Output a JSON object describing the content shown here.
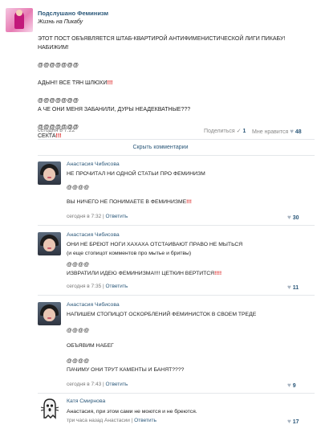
{
  "post": {
    "group_name": "Подслушано Феминизм",
    "subtitle": "Жизнь на Пикабу",
    "lines": [
      {
        "text": "ЭТОТ ПОСТ ОБЪЯВЛЯЕТСЯ ШТАБ-КВАРТИРОЙ АНТИФИМЕНИСТИЧЕСКОЙ ЛИГИ ПИКАБУ! НАБИЖИМ!"
      },
      {
        "text": "@@@@@@@"
      },
      {
        "text": "АДЫН!! ВСЕ ТЯН ШЛЮХИ",
        "suffix": "!!!"
      },
      {
        "text": "@@@@@@@"
      },
      {
        "text": "А ЧЕ ОНИ МЕНЯ ЗАБАНИЛИ, ДУРЫ НЕАДЕКВАТНЫЕ???"
      },
      {
        "text": "@@@@@@@"
      },
      {
        "text": "СЕКТА",
        "suffix": "!!!"
      }
    ],
    "date": "сегодня в 7:22",
    "share_label": "Поделиться",
    "share_count": "1",
    "like_label": "Мне нравится",
    "like_count": "48",
    "hide_comments": "Скрыть комментарии"
  },
  "comments": [
    {
      "author": "Анастасия Чибисова",
      "lines": [
        "НЕ ПРОЧИТАЛ НИ ОДНОЙ СТАТЬИ ПРО ФЕМИНИЗМ",
        "",
        "@@@@",
        "",
        "ВЫ НИЧЕГО НЕ ПОНИМАЕТЕ В ФЕМИНИЗМЕ"
      ],
      "last_suffix": "!!!",
      "date": "сегодня в 7:32",
      "reply": "Ответить",
      "likes": "30"
    },
    {
      "author": "Анастасия Чибисова",
      "lines": [
        "ОНИ НЕ БРЕЮТ НОГИ ХАХАХА ОТСТАИВАЮТ ПРАВО НЕ МЫТЬСЯ",
        "(и еще стопицот комментов про мытье и бритвы)",
        "",
        "@@@@",
        "ИЗВРАТИЛИ ИДЕЮ ФЕМИНИЗМА!!!! ЦЕТКИН ВЕРТИТСЯ"
      ],
      "last_suffix": "!!!!",
      "date": "сегодня в 7:35",
      "reply": "Ответить",
      "likes": "11"
    },
    {
      "author": "Анастасия Чибисова",
      "lines": [
        "НАПИШЕМ СТОПИЦОТ ОСКОРБЛЕНИЙ ФЕМИНИСТОК В СВОЕМ ТРЕДЕ",
        "",
        "@@@@",
        "",
        "ОБЪЯВИМ НАБЕГ",
        "",
        "@@@@",
        "ПАЧИМУ ОНИ ТРУТ КАМЕНТЫ И БАНЯТ????"
      ],
      "last_suffix": "",
      "date": "сегодня в 7:43",
      "reply": "Ответить",
      "likes": "9"
    },
    {
      "author": "Катя Смирнова",
      "lines": [
        "Анастасия, при этом сами не моются и не бреются."
      ],
      "last_suffix": "",
      "date": "три часа назад Анастасии",
      "reply": "Ответить",
      "likes": "17"
    }
  ],
  "icons": {
    "like": "heart-icon",
    "share": "megaphone-icon"
  },
  "colors": {
    "link": "#2b587a",
    "accent_red": "#dd2222"
  }
}
